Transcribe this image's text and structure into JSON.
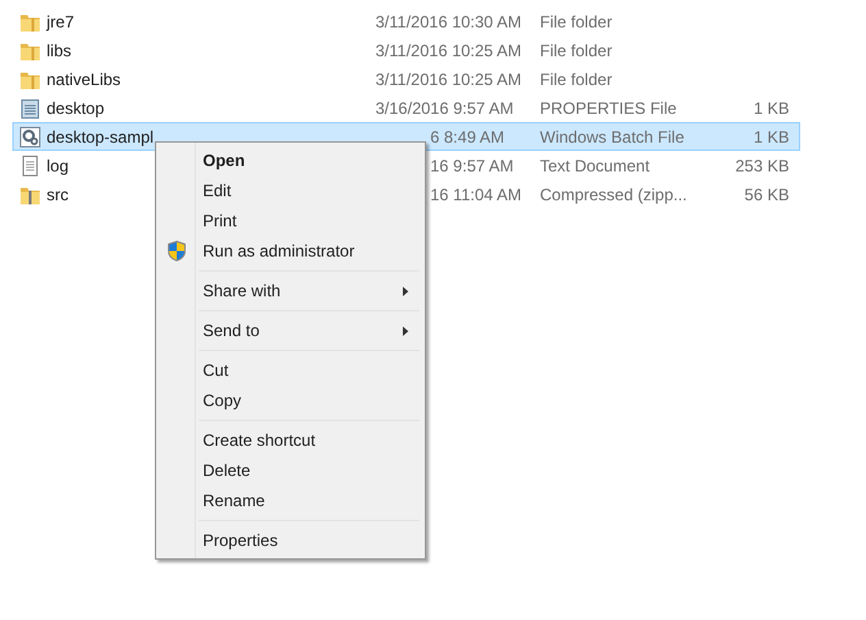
{
  "files": [
    {
      "name": "jre7",
      "date": "3/11/2016 10:30 AM",
      "type": "File folder",
      "kind": "folder",
      "selected": false,
      "covered": false
    },
    {
      "name": "libs",
      "date": "3/11/2016 10:25 AM",
      "type": "File folder",
      "kind": "folder",
      "selected": false,
      "covered": false
    },
    {
      "name": "nativeLibs",
      "date": "3/11/2016 10:25 AM",
      "type": "File folder",
      "kind": "folder",
      "selected": false,
      "covered": false
    },
    {
      "name": "desktop",
      "date": "3/16/2016 9:57 AM",
      "type": "PROPERTIES File",
      "size": "1 KB",
      "kind": "properties",
      "selected": false,
      "covered": false
    },
    {
      "name": "desktop-sampl",
      "date": "6 8:49 AM",
      "type": "Windows Batch File",
      "size": "1 KB",
      "kind": "batch",
      "selected": true,
      "covered": true
    },
    {
      "name": "log",
      "date": "16 9:57 AM",
      "type": "Text Document",
      "size": "253 KB",
      "kind": "text",
      "selected": false,
      "covered": true
    },
    {
      "name": "src",
      "date": "16 11:04 AM",
      "type": "Compressed (zipp...",
      "size": "56 KB",
      "kind": "zip",
      "selected": false,
      "covered": true
    }
  ],
  "context_menu": {
    "items": [
      {
        "kind": "item",
        "label": "Open",
        "default": true
      },
      {
        "kind": "item",
        "label": "Edit",
        "default": false
      },
      {
        "kind": "item",
        "label": "Print",
        "default": false
      },
      {
        "kind": "admin",
        "label": "Run as administrator",
        "default": false
      },
      {
        "kind": "separator"
      },
      {
        "kind": "submenu",
        "label": "Share with",
        "default": false
      },
      {
        "kind": "separator"
      },
      {
        "kind": "submenu",
        "label": "Send to",
        "default": false
      },
      {
        "kind": "separator"
      },
      {
        "kind": "item",
        "label": "Cut",
        "default": false
      },
      {
        "kind": "item",
        "label": "Copy",
        "default": false
      },
      {
        "kind": "separator"
      },
      {
        "kind": "item",
        "label": "Create shortcut",
        "default": false
      },
      {
        "kind": "item",
        "label": "Delete",
        "default": false
      },
      {
        "kind": "item",
        "label": "Rename",
        "default": false
      },
      {
        "kind": "separator"
      },
      {
        "kind": "item",
        "label": "Properties",
        "default": false
      }
    ]
  }
}
